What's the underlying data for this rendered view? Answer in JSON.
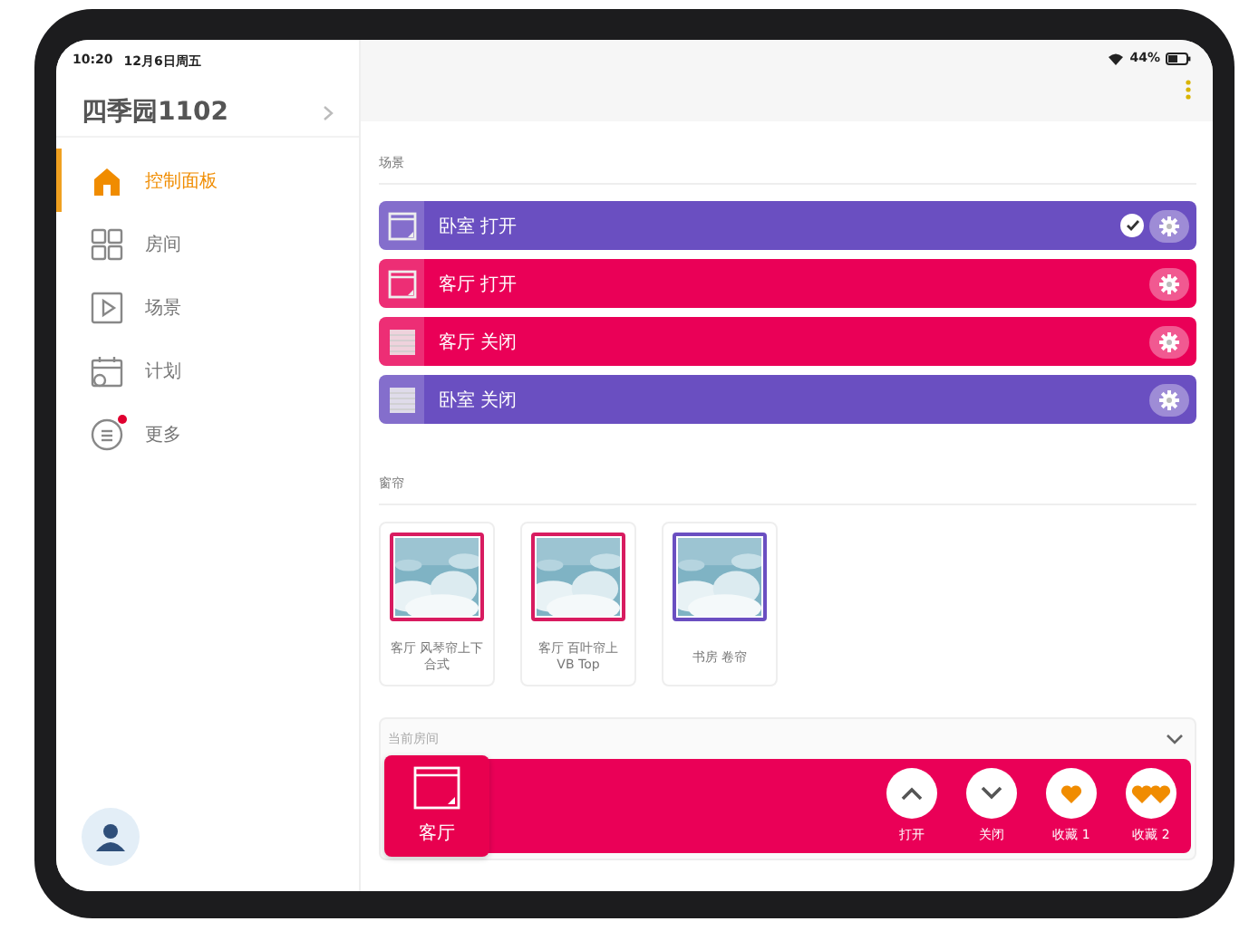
{
  "status_bar": {
    "time": "10:20",
    "date": "12月6日周五",
    "battery": "44%"
  },
  "sidebar": {
    "home_name": "四季园1102",
    "items": [
      {
        "label": "控制面板",
        "kind": "dashboard",
        "selected": true,
        "badge": false
      },
      {
        "label": "房间",
        "kind": "rooms",
        "selected": false,
        "badge": false
      },
      {
        "label": "场景",
        "kind": "scenes",
        "selected": false,
        "badge": false
      },
      {
        "label": "计划",
        "kind": "plans",
        "selected": false,
        "badge": false
      },
      {
        "label": "更多",
        "kind": "more",
        "selected": false,
        "badge": true
      }
    ]
  },
  "scenes": {
    "title": "场景",
    "items": [
      {
        "label": "卧室 打开",
        "kind": "window",
        "color": "#6a4fc1",
        "active": true
      },
      {
        "label": "客厅 打开",
        "kind": "window",
        "color": "#ea0057",
        "active": false
      },
      {
        "label": "客厅 关闭",
        "kind": "curtain",
        "color": "#ea0057",
        "active": false
      },
      {
        "label": "卧室 关闭",
        "kind": "curtain",
        "color": "#6a4fc1",
        "active": false
      }
    ]
  },
  "curtains": {
    "title": "窗帘",
    "items": [
      {
        "label": "客厅 风琴帘上下合式",
        "color": "#d81b60"
      },
      {
        "label": "客厅 百叶帘上VB Top",
        "color": "#d81b60"
      },
      {
        "label": "书房 卷帘",
        "color": "#6a4fc1"
      }
    ]
  },
  "current_room": {
    "title": "当前房间",
    "expanded": true,
    "room": "客厅",
    "actions": [
      {
        "label": "打开",
        "kind": "up"
      },
      {
        "label": "关闭",
        "kind": "down"
      },
      {
        "label": "收藏 1",
        "kind": "fav1"
      },
      {
        "label": "收藏 2",
        "kind": "fav2"
      }
    ]
  }
}
